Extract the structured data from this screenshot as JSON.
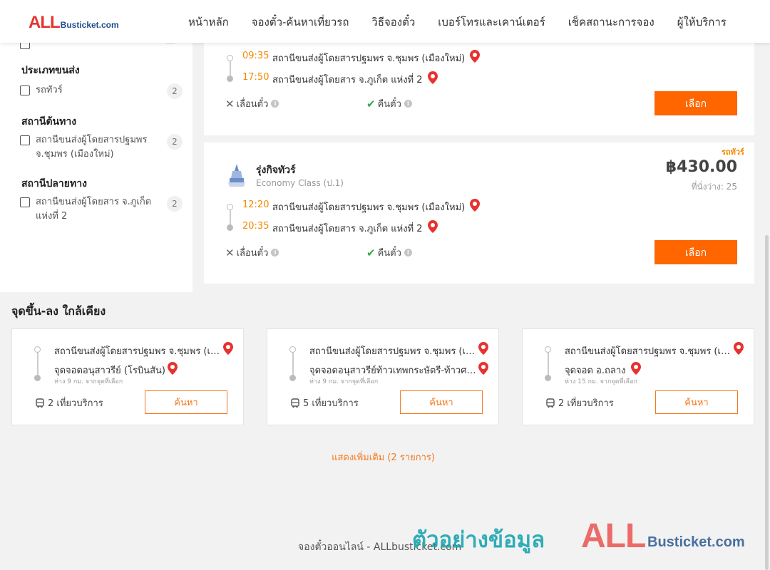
{
  "header": {
    "logo_all": "ALL",
    "logo_rest": "Busticket.com",
    "nav": [
      "หน้าหลัก",
      "จองตั๋ว-ค้นหาเที่ยวรถ",
      "วิธีจองตั๋ว",
      "เบอร์โทรและเคาน์เตอร์",
      "เช็คสถานะการจอง",
      "ผู้ให้บริการ"
    ]
  },
  "filters": {
    "transport_type": {
      "title": "ประเภทขนส่ง",
      "options": [
        {
          "label": "รถทัวร์",
          "count": "2"
        }
      ]
    },
    "origin": {
      "title": "สถานีต้นทาง",
      "options": [
        {
          "label": "สถานีขนส่งผู้โดยสารปฐมพร จ.ชุมพร (เมืองใหม่)",
          "count": "2"
        }
      ]
    },
    "destination": {
      "title": "สถานีปลายทาง",
      "options": [
        {
          "label": "สถานีขนส่งผู้โดยสาร จ.ภูเก็ต แห่งที่ 2",
          "count": "2"
        }
      ]
    }
  },
  "trips": [
    {
      "depart_time": "09:35",
      "depart_station": "สถานีขนส่งผู้โดยสารปฐมพร จ.ชุมพร (เมืองใหม่)",
      "arrive_time": "17:50",
      "arrive_station": "สถานีขนส่งผู้โดยสาร จ.ภูเก็ต แห่งที่ 2",
      "no_change": "เลื่อนตั๋ว",
      "refund": "คืนตั๋ว",
      "select": "เลือก"
    },
    {
      "category": "รถทัวร์",
      "operator": "รุ่งกิจทัวร์",
      "class": "Economy Class (ป.1)",
      "price": "฿430.00",
      "seats": "ที่นั่งว่าง: 25",
      "depart_time": "12:20",
      "depart_station": "สถานีขนส่งผู้โดยสารปฐมพร จ.ชุมพร (เมืองใหม่)",
      "arrive_time": "20:35",
      "arrive_station": "สถานีขนส่งผู้โดยสาร จ.ภูเก็ต แห่งที่ 2",
      "no_change": "เลื่อนตั๋ว",
      "refund": "คืนตั๋ว",
      "select": "เลือก"
    }
  ],
  "nearby": {
    "title": "จุดขึ้น-ลง ใกล้เคียง",
    "cards": [
      {
        "from": "สถานีขนส่งผู้โดยสารปฐมพร จ.ชุมพร (เมืองใหม่)",
        "to": "จุดจอดอนุสาวรีย์ (โรบินสัน)",
        "distance": "ห่าง 9 กม. จากจุดที่เลือก",
        "trips": "2 เที่ยวบริการ",
        "search": "ค้นหา"
      },
      {
        "from": "สถานีขนส่งผู้โดยสารปฐมพร จ.ชุมพร (เมืองใหม่)",
        "to": "จุดจอดอนุสาวรีย์ท้าวเทพกระษัตรี-ท้าวศรีสุนทร",
        "distance": "ห่าง 9 กม. จากจุดที่เลือก",
        "trips": "5 เที่ยวบริการ",
        "search": "ค้นหา"
      },
      {
        "from": "สถานีขนส่งผู้โดยสารปฐมพร จ.ชุมพร (เมืองใหม่)",
        "to": "จุดจอด อ.ถลาง",
        "distance": "ห่าง 15 กม. จากจุดที่เลือก",
        "trips": "2 เที่ยวบริการ",
        "search": "ค้นหา"
      }
    ],
    "show_more": "แสดงเพิ่มเติม (2 รายการ)"
  },
  "footer": "จองตั๋วออนไลน์ - ALLbusticket.com",
  "watermark": {
    "text": "ตัวอย่างข้อมูล",
    "all": "ALL",
    "rest": "Busticket.com"
  },
  "colors": {
    "accent": "#ff6600",
    "time": "#f28a00",
    "pin": "#e8322f",
    "check": "#2ea84a"
  }
}
